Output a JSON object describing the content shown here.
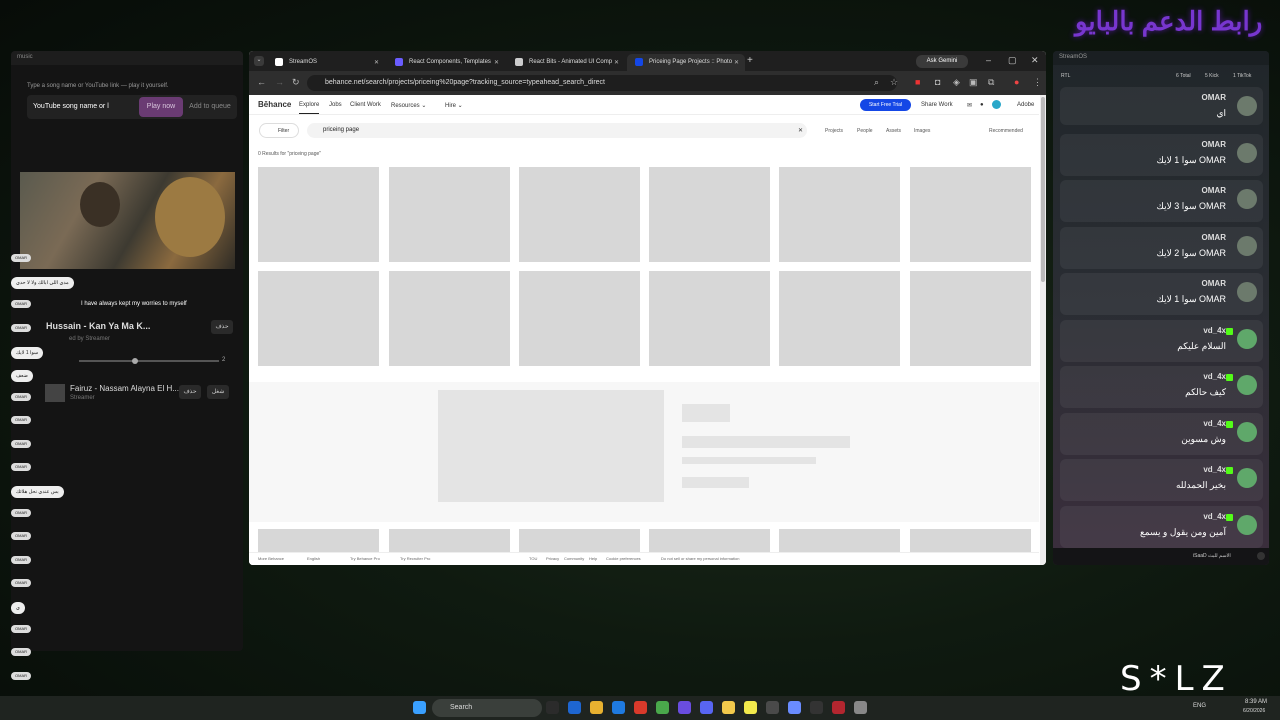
{
  "overlay": {
    "title": "رابط الدعم بالبايو",
    "brand": "S*LZ"
  },
  "music": {
    "window_title": "music",
    "hint": "Type a song name or YouTube link — play it yourself.",
    "input_value": "YouTube song name or l",
    "play_label": "Play now",
    "queue_label": "Add to queue",
    "subtitle": "I have always kept my worries to myself",
    "now_playing_title": "Hussain - Kan Ya Ma K...",
    "now_playing_sub": "ed by Streamer",
    "delete_label": "حذف",
    "time_right": "2",
    "queue_title": "Fairuz - Nassam Alayna El H...",
    "queue_sub": "Streamer",
    "run_label": "شغل"
  },
  "mini_chat": [
    "OMAR",
    "مدي اللي ابالك ولا لا حدي",
    "OMAR",
    "OMAR",
    "سوا 1 لايك",
    "ضعف",
    "OMAR",
    "OMAR",
    "OMAR",
    "OMAR",
    "بس عندي نحل هلائك",
    "OMAR",
    "OMAR",
    "OMAR",
    "OMAR",
    "ي",
    "OMAR",
    "OMAR",
    "OMAR"
  ],
  "browser": {
    "tabs": [
      {
        "label": "StreamOS",
        "color": "#ffffff"
      },
      {
        "label": "React Components, Templates",
        "color": "#6a5cff"
      },
      {
        "label": "React Bits - Animated UI Comp",
        "color": "#cccccc"
      },
      {
        "label": "Priceing Page Projects :: Photo",
        "color": "#1447e6"
      }
    ],
    "url": "behance.net/search/projects/priceing%20page?tracking_source=typeahead_search_direct",
    "gemini_label": "Ask Gemini",
    "nav": {
      "logo": "Bēhance",
      "items": [
        "Explore",
        "Jobs",
        "Client Work",
        "Resources ⌄",
        "Hire ⌄"
      ],
      "trial": "Start Free Trial",
      "share": "Share Work",
      "adobe": "Adobe"
    },
    "filter_label": "Filter",
    "search_value": "priceing page",
    "search_tabs": [
      "Projects",
      "People",
      "Assets",
      "Images"
    ],
    "sort_label": "Recommended",
    "results_text": "0 Results for \"priceing page\"",
    "footer": [
      "More Behance",
      "English",
      "Try Behance Pro",
      "Try Recruiter Pro",
      "TOU",
      "Privacy",
      "Community",
      "Help",
      "Cookie preferences",
      "Do not sell or share my personal information"
    ]
  },
  "chat": {
    "window_title": "StreamOS",
    "rtl_label": "RTL",
    "stats": {
      "total": "6 Total",
      "kick": "5 Kick",
      "tiktok": "1 TikTok"
    },
    "messages": [
      {
        "user": "OMAR",
        "text": "اي"
      },
      {
        "user": "OMAR",
        "text": "OMAR سوا 1 لايك"
      },
      {
        "user": "OMAR",
        "text": "OMAR سوا 3 لايك"
      },
      {
        "user": "OMAR",
        "text": "OMAR سوا 2 لايك"
      },
      {
        "user": "OMAR",
        "text": "OMAR سوا 1 لايك"
      },
      {
        "user": "vd_4x",
        "text": "السلام عليكم"
      },
      {
        "user": "vd_4x",
        "text": "كيف حالكم"
      },
      {
        "user": "vd_4x",
        "text": "وش مسوين"
      },
      {
        "user": "vd_4x",
        "text": "بخير الحمدلله"
      },
      {
        "user": "vd_4x",
        "text": "آمين ومن يقول و يسمع"
      }
    ],
    "footer_text": "iSaaD الاسم للبث"
  },
  "taskbar": {
    "search": "Search",
    "lang": "ENG",
    "time": "8:39 AM",
    "date": "6/20/2026"
  }
}
